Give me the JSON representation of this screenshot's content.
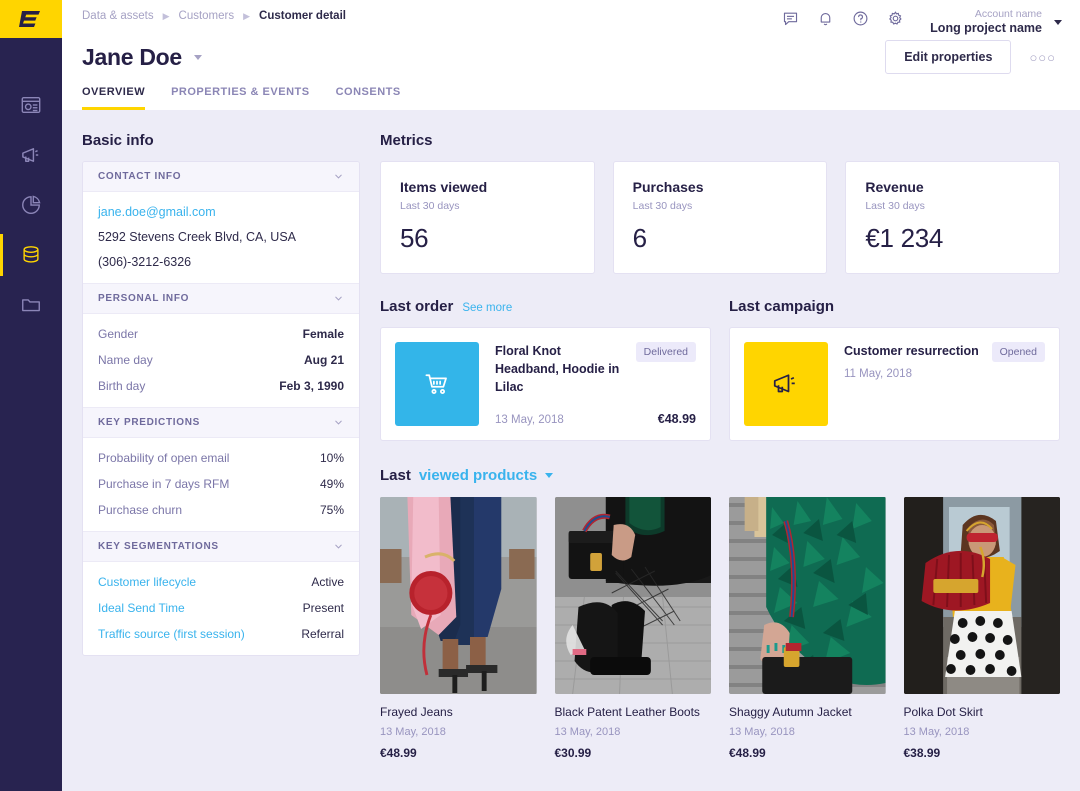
{
  "rail": {
    "logo": "exponea-logo",
    "items": [
      {
        "icon": "dashboard-icon",
        "name": "dashboards",
        "active": false
      },
      {
        "icon": "megaphone-icon",
        "name": "campaigns",
        "active": false
      },
      {
        "icon": "pie-chart-icon",
        "name": "analytics",
        "active": false
      },
      {
        "icon": "database-icon",
        "name": "data-and-assets",
        "active": true
      },
      {
        "icon": "folder-icon",
        "name": "projects",
        "active": false
      }
    ]
  },
  "header": {
    "breadcrumb": [
      {
        "label": "Data & assets",
        "current": false
      },
      {
        "label": "Customers",
        "current": false
      },
      {
        "label": "Customer detail",
        "current": true
      }
    ],
    "icons": [
      "chat-icon",
      "bell-icon",
      "help-icon",
      "gear-icon"
    ],
    "account_name": "Account name",
    "project_name": "Long project name",
    "customer_name": "Jane Doe",
    "edit_button": "Edit properties",
    "more_menu": "○○○",
    "tabs": [
      {
        "label": "OVERVIEW",
        "active": true
      },
      {
        "label": "PROPERTIES & EVENTS",
        "active": false
      },
      {
        "label": "CONSENTS",
        "active": false
      }
    ]
  },
  "basic_info": {
    "title": "Basic info",
    "contact": {
      "header": "CONTACT INFO",
      "email": "jane.doe@gmail.com",
      "address": "5292 Stevens Creek Blvd, CA, USA",
      "phone": "(306)-3212-6326"
    },
    "personal": {
      "header": "PERSONAL INFO",
      "rows": [
        {
          "key": "Gender",
          "value": "Female"
        },
        {
          "key": "Name day",
          "value": "Aug 21"
        },
        {
          "key": "Birth day",
          "value": "Feb 3, 1990"
        }
      ]
    },
    "predictions": {
      "header": "KEY PREDICTIONS",
      "rows": [
        {
          "key": "Probability of open email",
          "value": "10%"
        },
        {
          "key": "Purchase in 7 days RFM",
          "value": "49%"
        },
        {
          "key": "Purchase churn",
          "value": "75%"
        }
      ]
    },
    "segmentations": {
      "header": "KEY SEGMENTATIONS",
      "rows": [
        {
          "key": "Customer lifecycle",
          "value": "Active"
        },
        {
          "key": "Ideal Send Time",
          "value": "Present"
        },
        {
          "key": "Traffic source (first session)",
          "value": "Referral"
        }
      ]
    }
  },
  "metrics": {
    "title": "Metrics",
    "cards": [
      {
        "label": "Items viewed",
        "sub": "Last 30 days",
        "value": "56"
      },
      {
        "label": "Purchases",
        "sub": "Last 30 days",
        "value": "6"
      },
      {
        "label": "Revenue",
        "sub": "Last 30 days",
        "value": "€1 234"
      }
    ]
  },
  "last_order": {
    "title": "Last order",
    "see_more": "See more",
    "thumb_icon": "shopping-cart-icon",
    "product": "Floral Knot Headband, Hoodie in Lilac",
    "status": "Delivered",
    "date": "13 May, 2018",
    "price": "€48.99"
  },
  "last_campaign": {
    "title": "Last campaign",
    "thumb_icon": "megaphone-icon",
    "name": "Customer resurrection",
    "status": "Opened",
    "date": "11 May, 2018"
  },
  "products": {
    "heading_static": "Last",
    "heading_dynamic": "viewed products",
    "items": [
      {
        "name": "Frayed Jeans",
        "date": "13 May, 2018",
        "price": "€48.99",
        "image": "woman-in-frayed-jeans-with-red-round-bag"
      },
      {
        "name": "Black Patent Leather Boots",
        "date": "13 May, 2018",
        "price": "€30.99",
        "image": "black-boots-fishnet-tights-on-cobblestone"
      },
      {
        "name": "Shaggy Autumn Jacket",
        "date": "13 May, 2018",
        "price": "€48.99",
        "image": "green-shaggy-fur-jacket-with-black-bag"
      },
      {
        "name": "Polka Dot Skirt",
        "date": "13 May, 2018",
        "price": "€38.99",
        "image": "woman-red-bag-yellow-top-polka-dot-skirt"
      }
    ]
  },
  "colors": {
    "brand_yellow": "#ffd500",
    "rail_navy": "#282350",
    "link_blue": "#39b3ed",
    "page_bg": "#edecf7",
    "order_thumb": "#33b5e9"
  }
}
